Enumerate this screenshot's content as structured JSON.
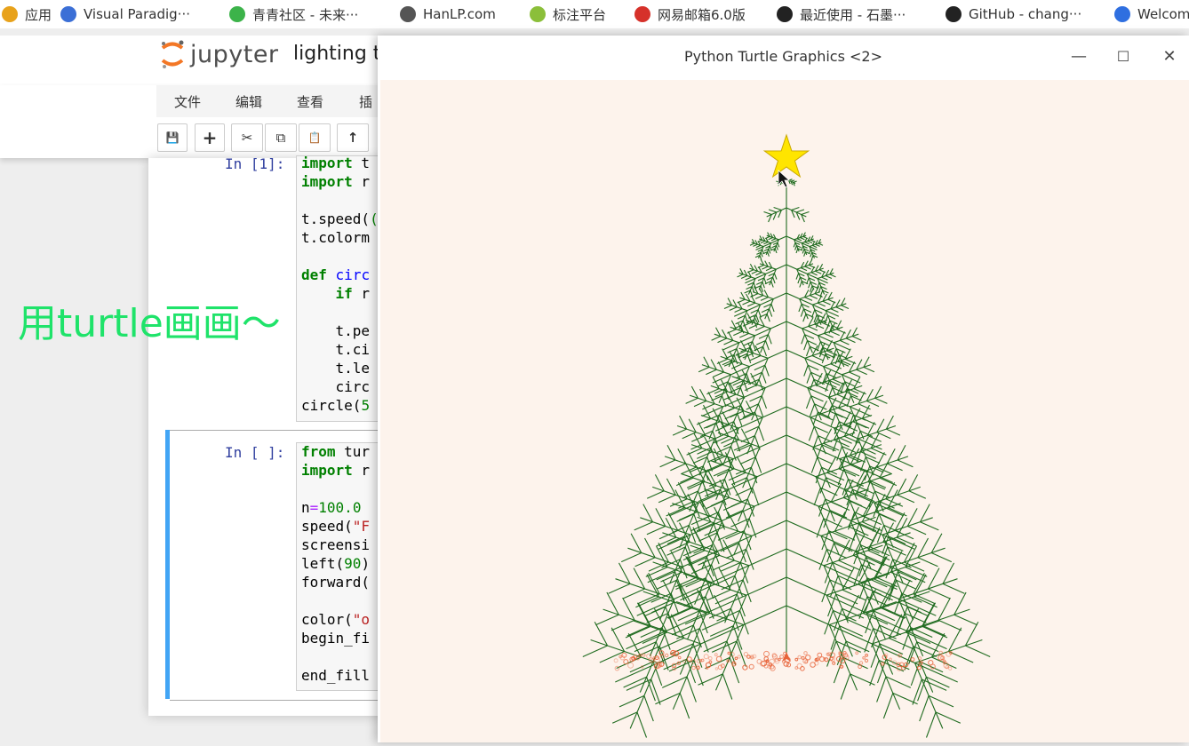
{
  "bookmarks": [
    {
      "label": "应用",
      "icon": "apps-grid-icon",
      "color": "#e8a21b"
    },
    {
      "label": "Visual Paradig···",
      "icon": "visual-paradigm-icon",
      "color": "#3b6fd6"
    },
    {
      "label": "青青社区 - 未来···",
      "icon": "leaf-icon",
      "color": "#3cb34a"
    },
    {
      "label": "HanLP.com",
      "icon": "globe-icon",
      "color": "#555555"
    },
    {
      "label": "标注平台",
      "icon": "flower-icon",
      "color": "#8bbf3a"
    },
    {
      "label": "网易邮箱6.0版",
      "icon": "netease-icon",
      "color": "#d6312a"
    },
    {
      "label": "最近使用 - 石墨···",
      "icon": "shimo-icon",
      "color": "#222222"
    },
    {
      "label": "GitHub - chang···",
      "icon": "github-icon",
      "color": "#222222"
    },
    {
      "label": "Welcom",
      "icon": "infinity-icon",
      "color": "#2f6fe0"
    }
  ],
  "jupyter": {
    "logo_text": "jupyter",
    "notebook_title": "lighting ta",
    "menu": [
      "文件",
      "编辑",
      "查看",
      "插"
    ],
    "toolbar": [
      "💾",
      "+",
      "✂",
      "⧉",
      "📋",
      "↑"
    ]
  },
  "cells": [
    {
      "prompt": "In [1]:",
      "lines": [
        [
          {
            "t": "import",
            "c": "kw"
          },
          {
            "t": " t",
            "c": ""
          }
        ],
        [
          {
            "t": "import",
            "c": "kw"
          },
          {
            "t": " r",
            "c": ""
          }
        ],
        [
          {
            "t": "",
            "c": ""
          }
        ],
        [
          {
            "t": "t.speed(",
            "c": ""
          },
          {
            "t": "(",
            "c": "num"
          }
        ],
        [
          {
            "t": "t.colorm",
            "c": ""
          }
        ],
        [
          {
            "t": "",
            "c": ""
          }
        ],
        [
          {
            "t": "def",
            "c": "kw"
          },
          {
            "t": " ",
            "c": ""
          },
          {
            "t": "circ",
            "c": "fn"
          }
        ],
        [
          {
            "t": "    ",
            "c": ""
          },
          {
            "t": "if",
            "c": "kw"
          },
          {
            "t": " r",
            "c": ""
          }
        ],
        [
          {
            "t": "",
            "c": ""
          }
        ],
        [
          {
            "t": "    t.pe",
            "c": ""
          }
        ],
        [
          {
            "t": "    t.ci",
            "c": ""
          }
        ],
        [
          {
            "t": "    t.le",
            "c": ""
          }
        ],
        [
          {
            "t": "    circ",
            "c": ""
          }
        ],
        [
          {
            "t": "circle(",
            "c": ""
          },
          {
            "t": "5",
            "c": "num"
          }
        ]
      ]
    },
    {
      "prompt": "In [ ]:",
      "lines": [
        [
          {
            "t": "from",
            "c": "kw"
          },
          {
            "t": " tur",
            "c": ""
          }
        ],
        [
          {
            "t": "import",
            "c": "kw"
          },
          {
            "t": " r",
            "c": ""
          }
        ],
        [
          {
            "t": "",
            "c": ""
          }
        ],
        [
          {
            "t": "n",
            "c": ""
          },
          {
            "t": "=",
            "c": "op"
          },
          {
            "t": "100.0",
            "c": "num"
          }
        ],
        [
          {
            "t": "speed(",
            "c": ""
          },
          {
            "t": "\"F",
            "c": "str"
          }
        ],
        [
          {
            "t": "screensi",
            "c": ""
          }
        ],
        [
          {
            "t": "left(",
            "c": ""
          },
          {
            "t": "90",
            "c": "num"
          },
          {
            "t": ")",
            "c": ""
          }
        ],
        [
          {
            "t": "forward(",
            "c": ""
          }
        ],
        [
          {
            "t": "",
            "c": ""
          }
        ],
        [
          {
            "t": "color(",
            "c": ""
          },
          {
            "t": "\"o",
            "c": "str"
          }
        ],
        [
          {
            "t": "begin_fi",
            "c": ""
          }
        ],
        [
          {
            "t": "",
            "c": ""
          }
        ],
        [
          {
            "t": "end_fill",
            "c": ""
          }
        ]
      ]
    }
  ],
  "overlay_text": "用turtle画画～",
  "turtle_window": {
    "title": "Python Turtle Graphics <2>",
    "minimize": "—",
    "maximize": "☐",
    "close": "✕",
    "bg_color": "#fdf3ec",
    "tree_color": "#1f6b1f",
    "star_color": "#ffe500",
    "light_color": "#e8643a"
  }
}
